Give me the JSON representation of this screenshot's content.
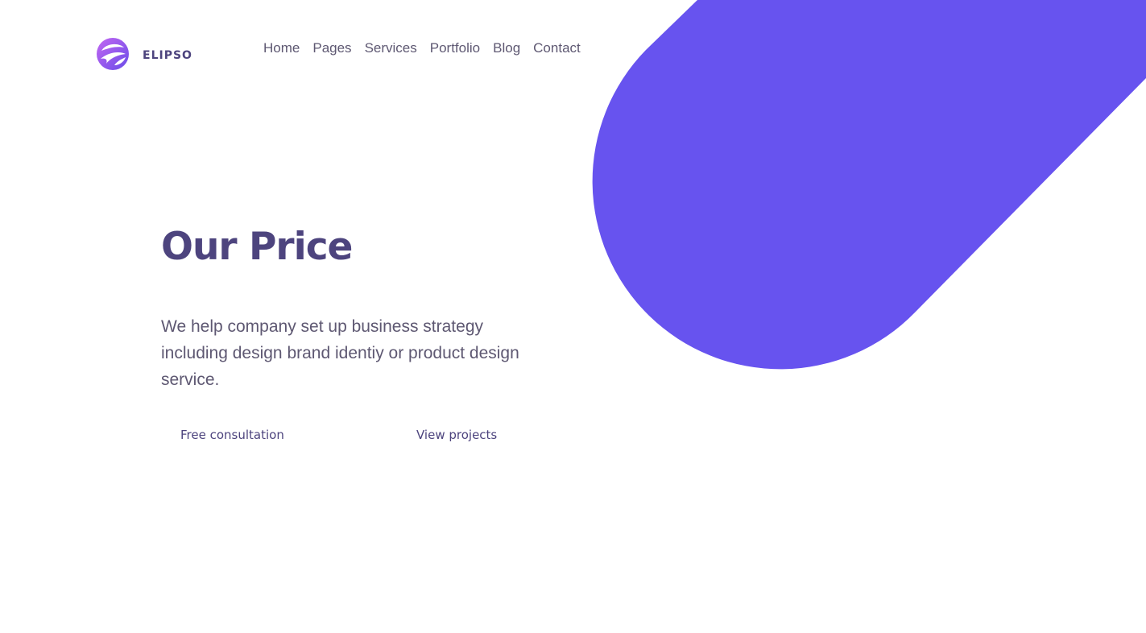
{
  "brand": {
    "name": "ELIPSO",
    "logo_icon": "elipso-swirl-logo",
    "accent_color": "#6753ef"
  },
  "nav": {
    "items": [
      {
        "label": "Home"
      },
      {
        "label": "Pages"
      },
      {
        "label": "Services"
      },
      {
        "label": "Portfolio"
      },
      {
        "label": "Blog"
      },
      {
        "label": "Contact"
      }
    ]
  },
  "hero": {
    "title": "Our Price",
    "description": "We help company set up business strategy including design brand identiy or product design service.",
    "primary_button": "Free consultation",
    "secondary_button": "View projects"
  },
  "colors": {
    "heading": "#4d447e",
    "body_text": "#5e5872",
    "background": "#ffffff",
    "decorative_shape": "#6753ef"
  }
}
